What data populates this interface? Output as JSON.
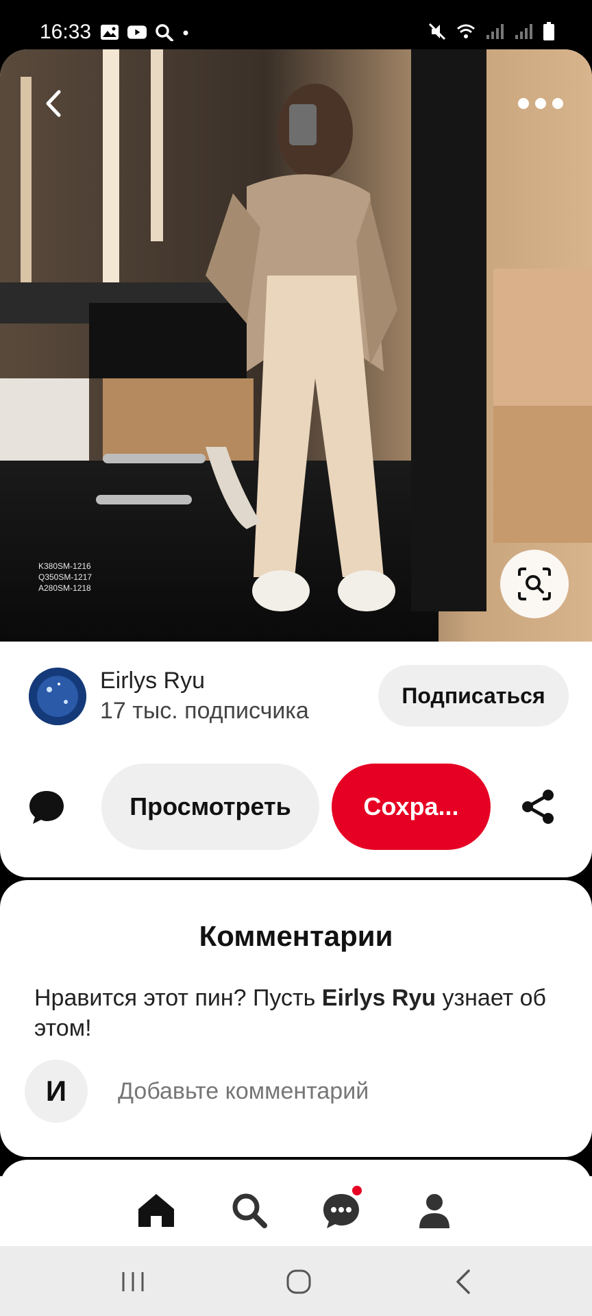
{
  "status_bar": {
    "time": "16:33",
    "left_icons": [
      "image-icon",
      "youtube-icon",
      "search-icon",
      "dot-icon"
    ],
    "right_icons": [
      "mute-icon",
      "wifi-icon",
      "signal-icon",
      "signal-icon",
      "battery-icon"
    ]
  },
  "pin": {
    "image_overlay_text": [
      "K380SM-1216",
      "Q350SM-1217",
      "A280SM-1218"
    ],
    "icons": {
      "back": "chevron-left-icon",
      "more": "more-dots-icon",
      "visual_search": "visual-search-icon"
    }
  },
  "creator": {
    "name": "Eirlys Ryu",
    "followers": "17 тыс. подписчика",
    "follow_label": "Подписаться"
  },
  "actions": {
    "view_label": "Просмотреть",
    "save_label": "Сохра...",
    "icons": {
      "comment": "comment-bubble-icon",
      "share": "share-icon"
    }
  },
  "comments": {
    "title": "Комментарии",
    "prompt_before": "Нравится этот пин? Пусть ",
    "prompt_name": "Eirlys Ryu",
    "prompt_after": " узнает об этом!",
    "user_initial": "И",
    "input_placeholder": "Добавьте комментарий"
  },
  "bottom_nav": {
    "items": [
      "home-icon",
      "search-icon",
      "messages-icon",
      "profile-icon"
    ],
    "notification": true
  },
  "system_nav": [
    "recent-apps-icon",
    "home-circle-icon",
    "back-icon"
  ],
  "colors": {
    "accent": "#e60023",
    "button_gray": "#efefef",
    "text": "#111111",
    "placeholder": "#767676"
  }
}
